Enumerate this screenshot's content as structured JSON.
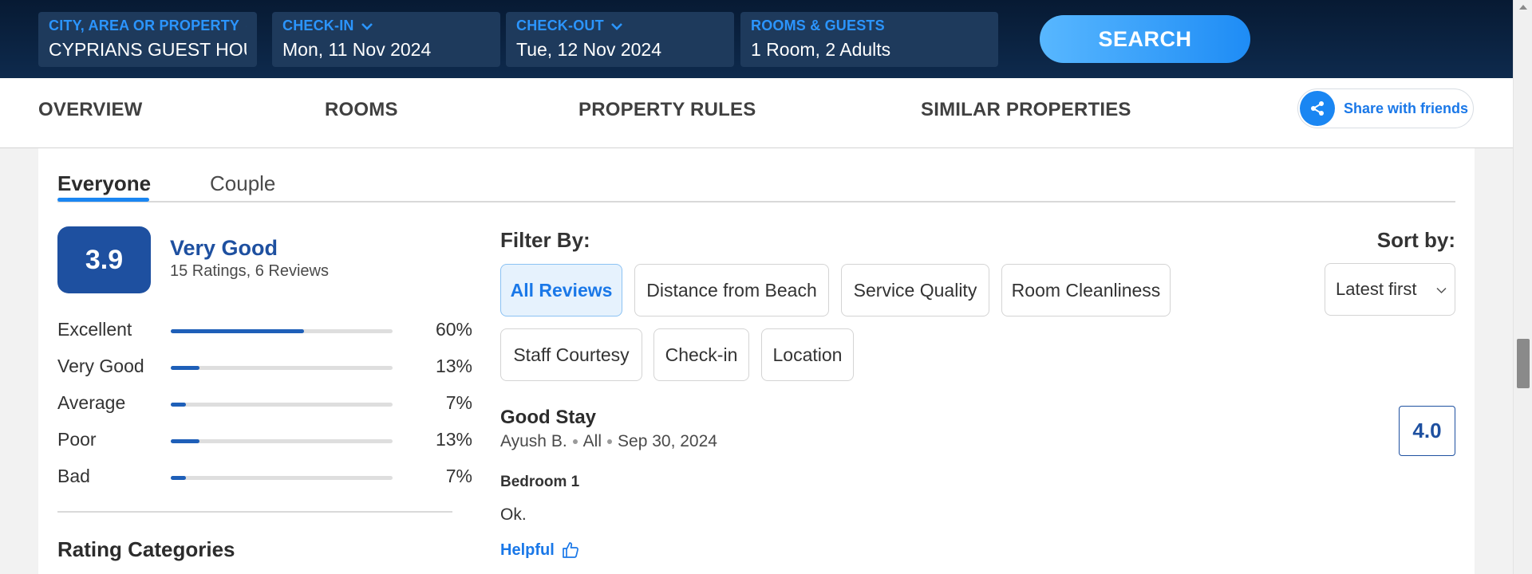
{
  "search": {
    "city_label": "CITY, AREA OR PROPERTY",
    "city_value": "CYPRIANS GUEST HOUSE",
    "checkin_label": "CHECK-IN",
    "checkin_value": "Mon, 11 Nov 2024",
    "checkout_label": "CHECK-OUT",
    "checkout_value": "Tue, 12 Nov 2024",
    "rooms_label": "ROOMS & GUESTS",
    "rooms_value": "1 Room, 2 Adults",
    "button_label": "SEARCH"
  },
  "nav": {
    "overview": "OVERVIEW",
    "rooms": "ROOMS",
    "property_rules": "PROPERTY RULES",
    "similar_properties": "SIMILAR PROPERTIES",
    "share_label": "Share with friends"
  },
  "tabs": {
    "everyone": "Everyone",
    "couple": "Couple",
    "active": "Everyone"
  },
  "summary": {
    "score": "3.9",
    "rating_word": "Very Good",
    "counts": "15 Ratings, 6 Reviews"
  },
  "distribution": [
    {
      "label": "Excellent",
      "percent": 60,
      "percent_text": "60%"
    },
    {
      "label": "Very Good",
      "percent": 13,
      "percent_text": "13%"
    },
    {
      "label": "Average",
      "percent": 7,
      "percent_text": "7%"
    },
    {
      "label": "Poor",
      "percent": 13,
      "percent_text": "13%"
    },
    {
      "label": "Bad",
      "percent": 7,
      "percent_text": "7%"
    }
  ],
  "rating_categories_title": "Rating Categories",
  "filters": {
    "title": "Filter By:",
    "chips": [
      "All Reviews",
      "Distance from Beach",
      "Service Quality",
      "Room Cleanliness",
      "Staff Courtesy",
      "Check-in",
      "Location"
    ],
    "active": "All Reviews"
  },
  "sort": {
    "title": "Sort by:",
    "selected": "Latest first"
  },
  "review": {
    "title": "Good Stay",
    "author": "Ayush B.",
    "category": "All",
    "date": "Sep 30, 2024",
    "score": "4.0",
    "room": "Bedroom 1",
    "text": "Ok.",
    "helpful_label": "Helpful"
  },
  "colors": {
    "accent_blue": "#1a86f2",
    "score_navy": "#1e50a0",
    "topbar_bg": "#0e2a4d"
  },
  "icons": {
    "chevron": "chevron-down-icon",
    "share": "share-icon",
    "thumbs_up": "thumbs-up-icon"
  }
}
